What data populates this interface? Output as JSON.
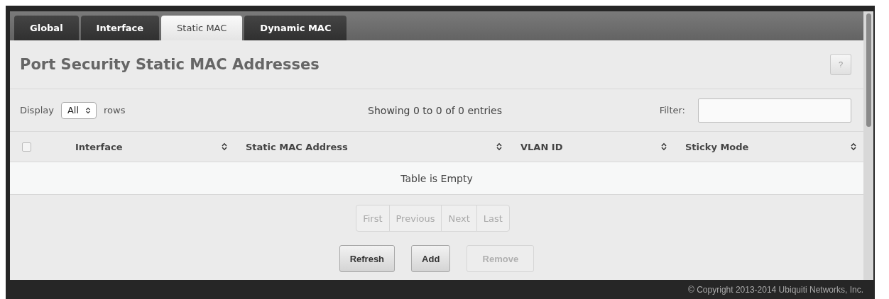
{
  "tabs": [
    {
      "label": "Global",
      "selected": false
    },
    {
      "label": "Interface",
      "selected": false
    },
    {
      "label": "Static MAC",
      "selected": true
    },
    {
      "label": "Dynamic MAC",
      "selected": false
    }
  ],
  "title": "Port Security Static MAC Addresses",
  "help_button": "?",
  "display": {
    "label": "Display",
    "value": "All",
    "suffix": "rows"
  },
  "info": "Showing 0 to 0 of 0 entries",
  "filter": {
    "label": "Filter:"
  },
  "table": {
    "select_all": {
      "checked": false
    },
    "columns": [
      "Interface",
      "Static MAC Address",
      "VLAN ID",
      "Sticky Mode"
    ],
    "empty_text": "Table is Empty"
  },
  "pager": [
    {
      "label": "First",
      "disabled": true
    },
    {
      "label": "Previous",
      "disabled": true
    },
    {
      "label": "Next",
      "disabled": true
    },
    {
      "label": "Last",
      "disabled": true
    }
  ],
  "buttons": [
    {
      "label": "Refresh",
      "disabled": false
    },
    {
      "label": "Add",
      "disabled": false
    },
    {
      "label": "Remove",
      "disabled": true
    }
  ],
  "footer": "© Copyright 2013-2014 Ubiquiti Networks, Inc."
}
